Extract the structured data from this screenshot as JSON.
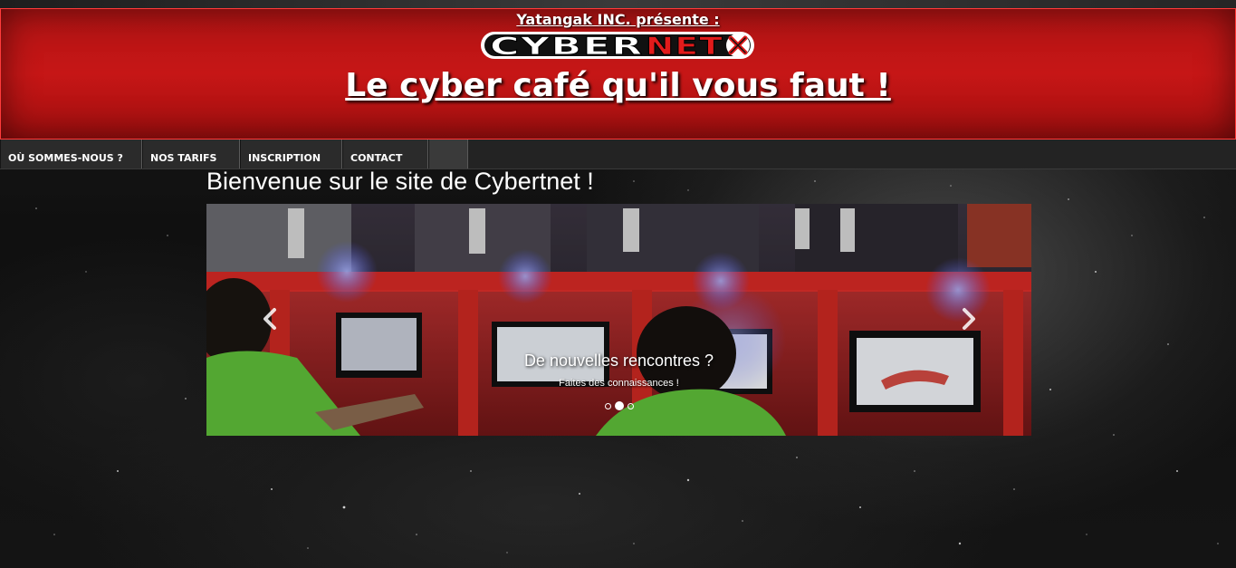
{
  "header": {
    "presents": "Yatangak INC. présente :",
    "logo_text": "CYBERNET",
    "tagline": "Le cyber café qu'il vous faut !"
  },
  "nav": {
    "items": [
      {
        "label": "OÙ SOMMES-NOUS ?"
      },
      {
        "label": "NOS TARIFS"
      },
      {
        "label": "INSCRIPTION"
      },
      {
        "label": "CONTACT"
      },
      {
        "label": ""
      }
    ]
  },
  "main": {
    "welcome": "Bienvenue sur le site de Cybertnet !"
  },
  "carousel": {
    "caption_title": "De nouvelles rencontres ?",
    "caption_text": "Faites des connaissances !",
    "slide_count": 3,
    "active_slide": 2,
    "prev_icon": "chevron-left-icon",
    "next_icon": "chevron-right-icon"
  },
  "colors": {
    "header_red": "#c01616",
    "header_border": "#ff3a3a",
    "nav_bg": "#2b2b2b",
    "text": "#ffffff"
  }
}
